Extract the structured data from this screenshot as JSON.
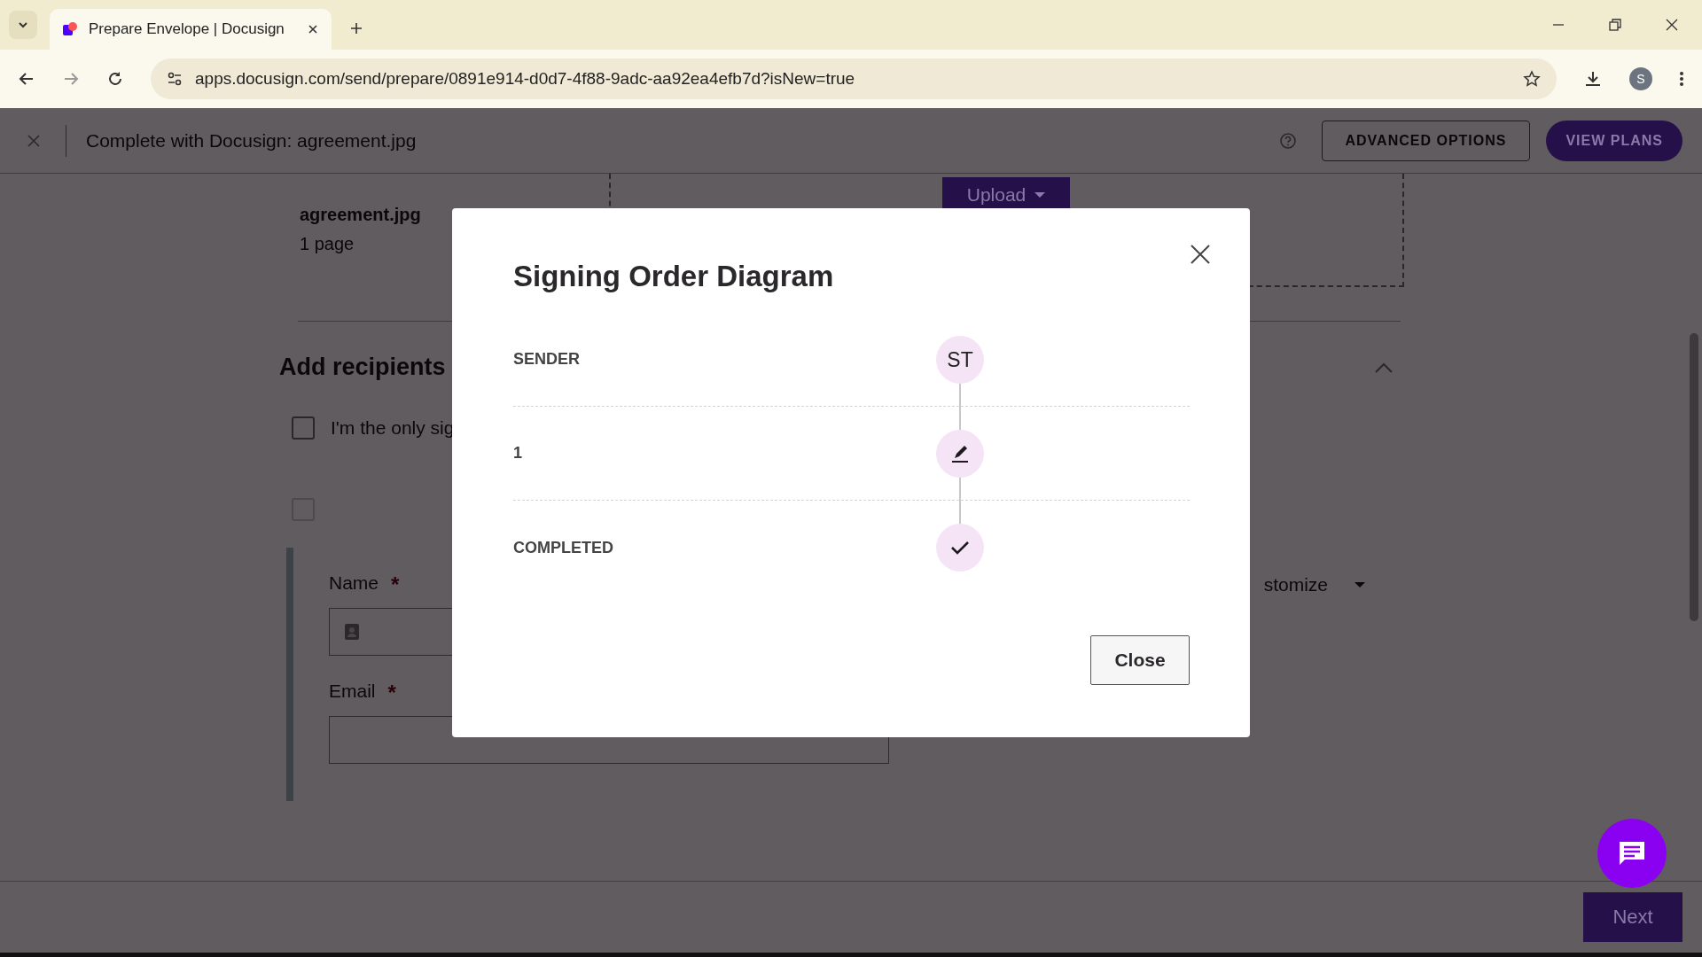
{
  "browser": {
    "tab_title": "Prepare Envelope | Docusign",
    "url": "apps.docusign.com/send/prepare/0891e914-d0d7-4f88-9adc-aa92ea4efb7d?isNew=true",
    "profile_initial": "S"
  },
  "header": {
    "title": "Complete with Docusign: agreement.jpg",
    "buttons": [
      "ADVANCED OPTIONS",
      "VIEW PLANS"
    ]
  },
  "document": {
    "upload_button": "Upload",
    "file_name": "agreement.jpg",
    "pages": "1 page"
  },
  "recipients": {
    "heading": "Add recipients",
    "checkboxes": [
      {
        "label": "I'm the only sig",
        "checked": false
      },
      {
        "checked": false
      }
    ],
    "name_label": "Name",
    "email_label": "Email",
    "required_mark": "*",
    "customize": "stomize"
  },
  "footer": {
    "next_button": "Next"
  },
  "dialog": {
    "title": "Signing Order Diagram",
    "steps": [
      {
        "label": "SENDER",
        "kind": "initials",
        "badge": "ST"
      },
      {
        "label": "1",
        "kind": "sign"
      },
      {
        "label": "COMPLETED",
        "kind": "done"
      }
    ],
    "close_button": "Close"
  }
}
